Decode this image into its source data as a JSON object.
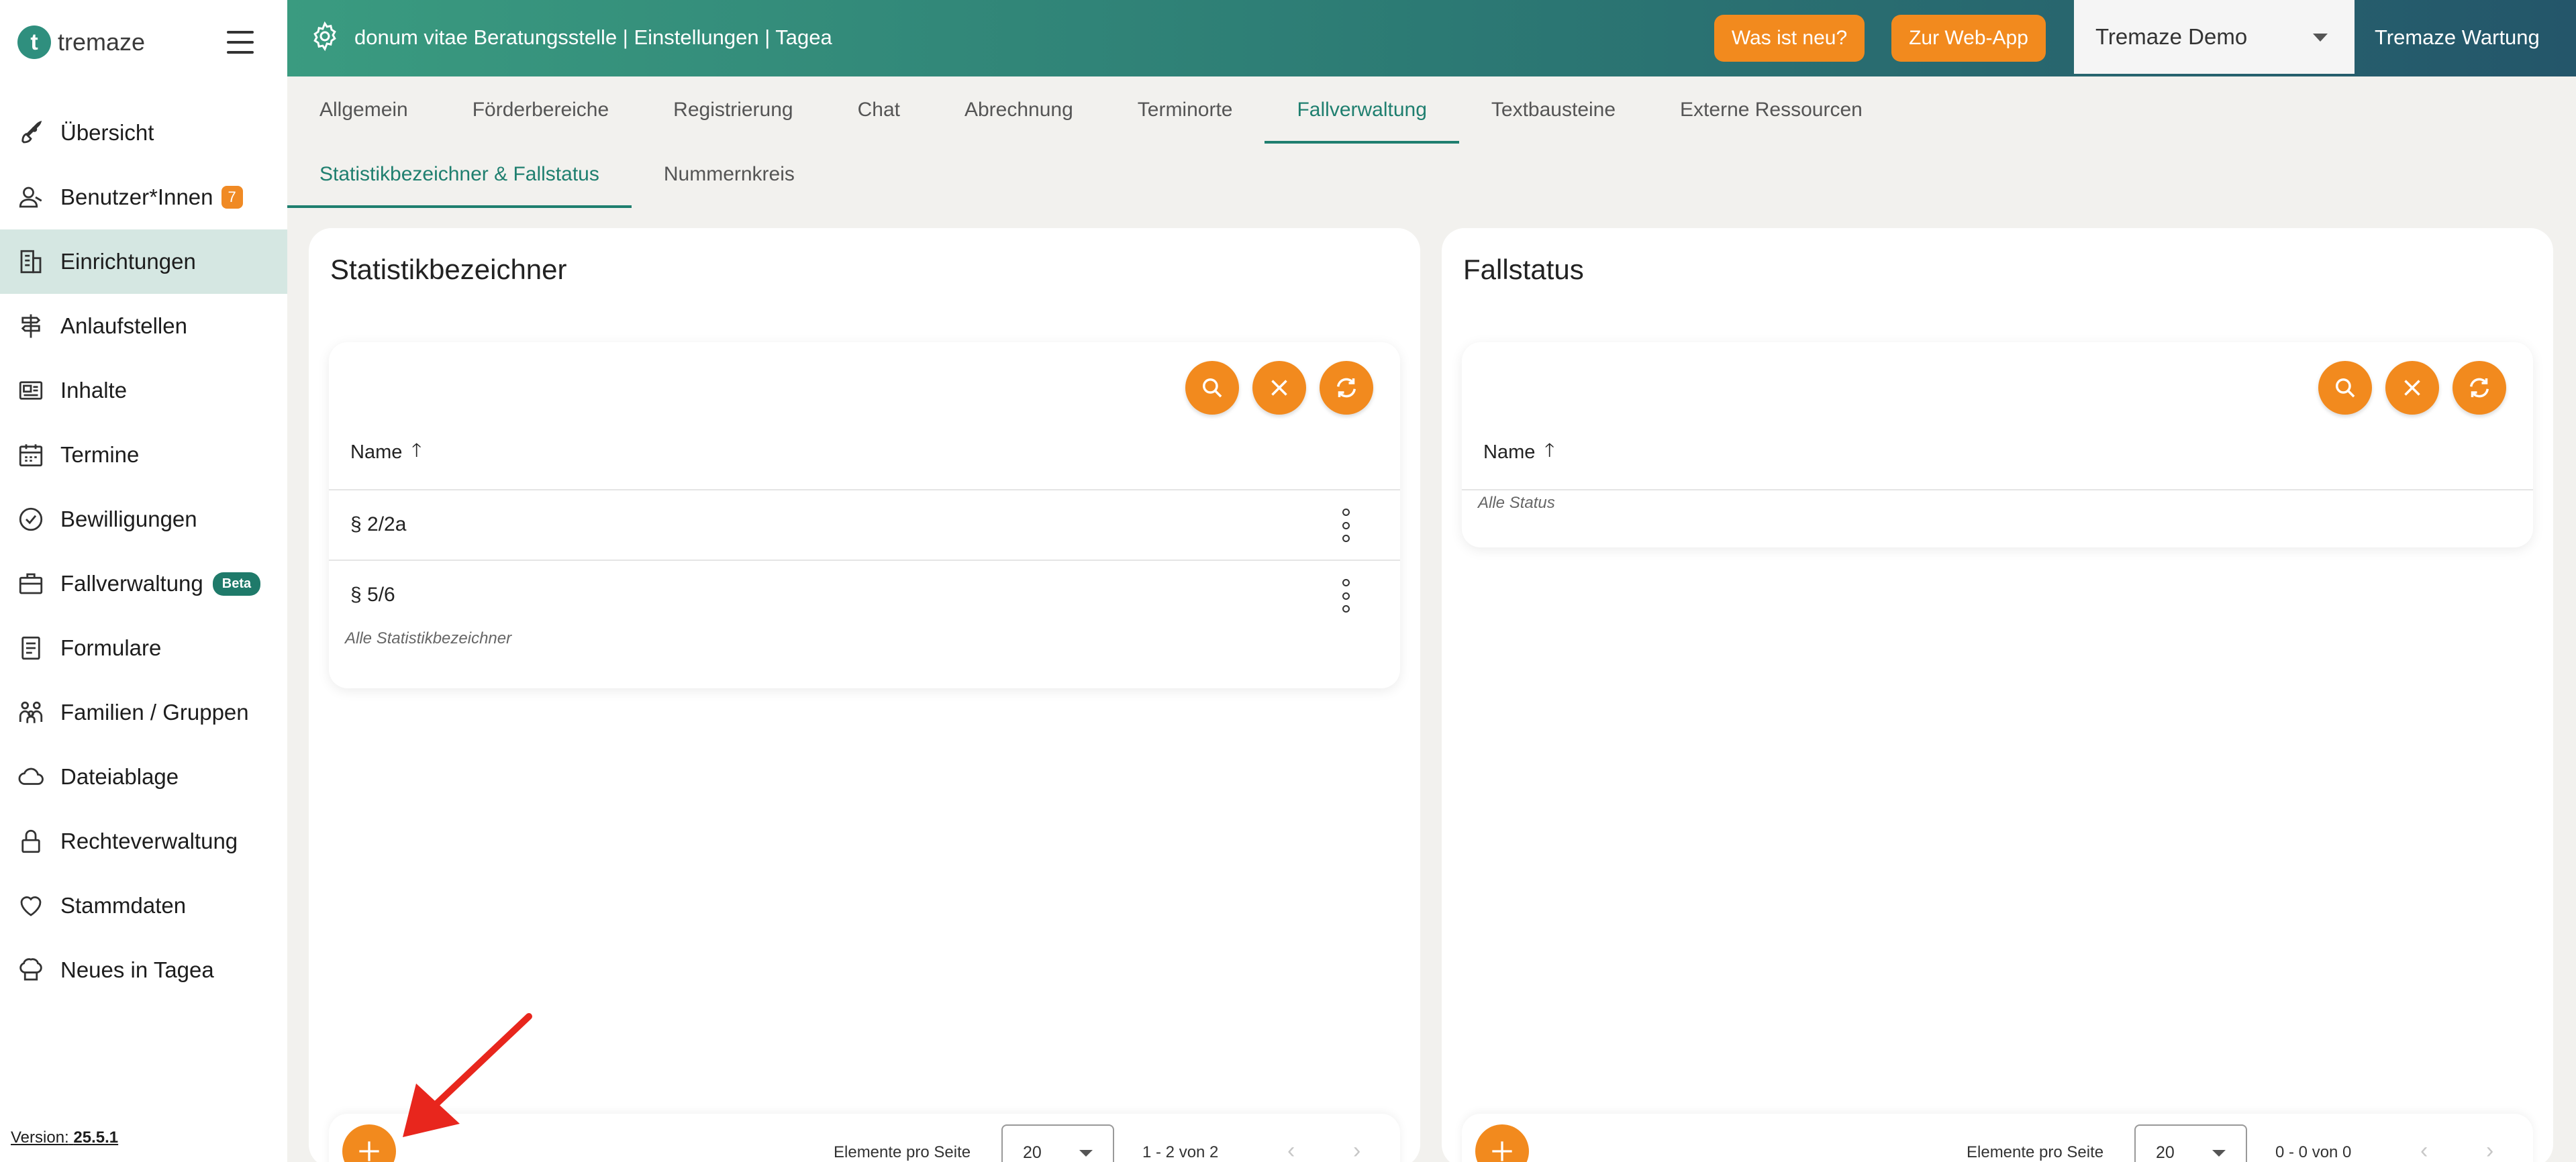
{
  "app": {
    "logo_letter": "t",
    "logo_text": "tremaze"
  },
  "header": {
    "title": "donum vitae Beratungsstelle | Einstellungen | Tagea",
    "whats_new": "Was ist neu?",
    "web_app": "Zur Web-App",
    "tenant_select": "Tremaze Demo",
    "maintenance": "Tremaze Wartung"
  },
  "sidebar": {
    "items": [
      {
        "label": "Übersicht",
        "icon": "rocket-icon"
      },
      {
        "label": "Benutzer*Innen",
        "icon": "users-icon",
        "badge": "7"
      },
      {
        "label": "Einrichtungen",
        "icon": "building-icon",
        "active": true
      },
      {
        "label": "Anlaufstellen",
        "icon": "signpost-icon"
      },
      {
        "label": "Inhalte",
        "icon": "newspaper-icon"
      },
      {
        "label": "Termine",
        "icon": "calendar-icon"
      },
      {
        "label": "Bewilligungen",
        "icon": "check-circle-icon"
      },
      {
        "label": "Fallverwaltung",
        "icon": "briefcase-icon",
        "badge": "Beta"
      },
      {
        "label": "Formulare",
        "icon": "form-icon"
      },
      {
        "label": "Familien / Gruppen",
        "icon": "family-icon"
      },
      {
        "label": "Dateiablage",
        "icon": "cloud-icon"
      },
      {
        "label": "Rechteverwaltung",
        "icon": "lock-icon"
      },
      {
        "label": "Stammdaten",
        "icon": "heart-icon"
      },
      {
        "label": "Neues in Tagea",
        "icon": "chef-hat-icon"
      }
    ],
    "version_label": "Version:",
    "version_value": "25.5.1"
  },
  "tabs": [
    "Allgemein",
    "Förderbereiche",
    "Registrierung",
    "Chat",
    "Abrechnung",
    "Terminorte",
    "Fallverwaltung",
    "Textbausteine",
    "Externe Ressourcen"
  ],
  "active_tab": "Fallverwaltung",
  "subtabs": [
    "Statistikbezeichner & Fallstatus",
    "Nummernkreis"
  ],
  "active_subtab": "Statistikbezeichner & Fallstatus",
  "left_panel": {
    "title": "Statistikbezeichner",
    "column_header": "Name",
    "rows": [
      "§ 2/2a",
      "§ 5/6"
    ],
    "footnote": "Alle Statistikbezeichner",
    "paginator": {
      "per_page_label": "Elemente pro Seite",
      "per_page_value": "20",
      "range": "1 - 2 von 2"
    }
  },
  "right_panel": {
    "title": "Fallstatus",
    "column_header": "Name",
    "rows": [],
    "footnote": "Alle Status",
    "paginator": {
      "per_page_label": "Elemente pro Seite",
      "per_page_value": "20",
      "range": "0 - 0 von 0"
    }
  },
  "colors": {
    "accent": "#f28a1e",
    "primary": "#1f7f6f",
    "header_start": "#3a9b80",
    "header_end": "#24566a",
    "annotation": "#e8261d"
  }
}
